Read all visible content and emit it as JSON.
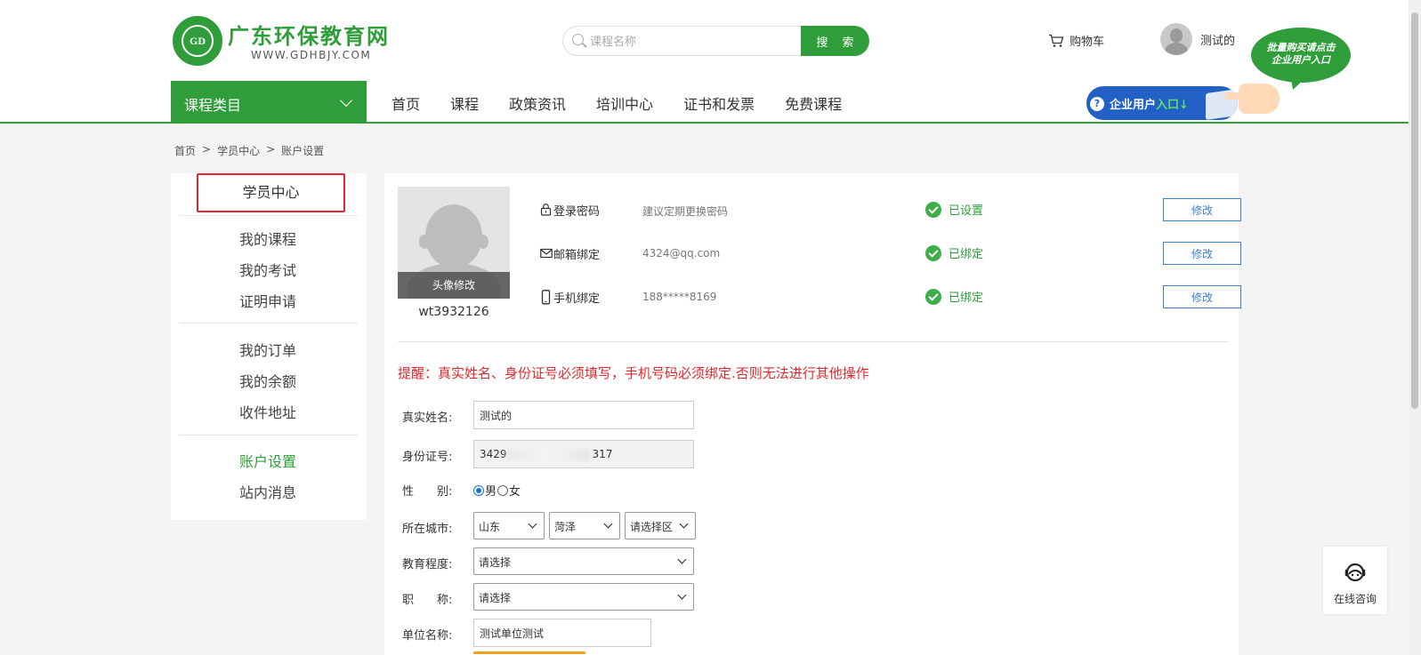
{
  "header": {
    "logo_badge": "GD",
    "site_name": "广东环保教育网",
    "site_domain": "WWW.GDHBJY.COM",
    "search_placeholder": "课程名称",
    "search_button": "搜 索",
    "cart_label": "购物车",
    "user_name": "测试的",
    "bubble_line1": "批量购买请点击",
    "bubble_line2": "企业用户入口",
    "enterprise_prefix": "企业用户",
    "enterprise_highlight": "入口↓"
  },
  "nav": {
    "category_label": "课程类目",
    "items": [
      "首页",
      "课程",
      "政策资讯",
      "培训中心",
      "证书和发票",
      "免费课程"
    ]
  },
  "breadcrumb": [
    "首页",
    ">",
    "学员中心",
    ">",
    "账户设置"
  ],
  "sidebar": {
    "title": "学员中心",
    "group1": [
      "我的课程",
      "我的考试",
      "证明申请"
    ],
    "group2": [
      "我的订单",
      "我的余额",
      "收件地址"
    ],
    "group3": [
      "账户设置",
      "站内消息"
    ],
    "active": "账户设置"
  },
  "profile": {
    "avatar_edit": "头像修改",
    "username": "wt3932126"
  },
  "security": [
    {
      "label": "登录密码",
      "value": "建议定期更换密码",
      "status": "已设置",
      "button": "修改",
      "icon": "lock-icon"
    },
    {
      "label": "邮箱绑定",
      "value": "4324@qq.com",
      "status": "已绑定",
      "button": "修改",
      "icon": "mail-icon"
    },
    {
      "label": "手机绑定",
      "value": "188*****8169",
      "status": "已绑定",
      "button": "修改",
      "icon": "phone-icon"
    }
  ],
  "notice": "提醒：真实姓名、身份证号必须填写，手机号码必须绑定.否则无法进行其他操作",
  "form": {
    "real_name_label": "真实姓名:",
    "real_name_value": "测试的",
    "id_label": "身份证号:",
    "id_prefix": "3429",
    "id_suffix": "317",
    "gender_label": "性　　别:",
    "gender_male": "男",
    "gender_female": "女",
    "gender_selected": "男",
    "city_label": "所在城市:",
    "province": "山东",
    "city": "菏泽",
    "district": "请选择区",
    "education_label": "教育程度:",
    "education": "请选择",
    "title_label": "职　　称:",
    "title": "请选择",
    "company_label": "单位名称:",
    "company_value": "测试单位测试"
  },
  "consult": {
    "label": "在线咨询"
  },
  "colors": {
    "brand_green": "#2e9d3a",
    "alert_red": "#e0282e",
    "link_blue": "#3a7fd4"
  }
}
